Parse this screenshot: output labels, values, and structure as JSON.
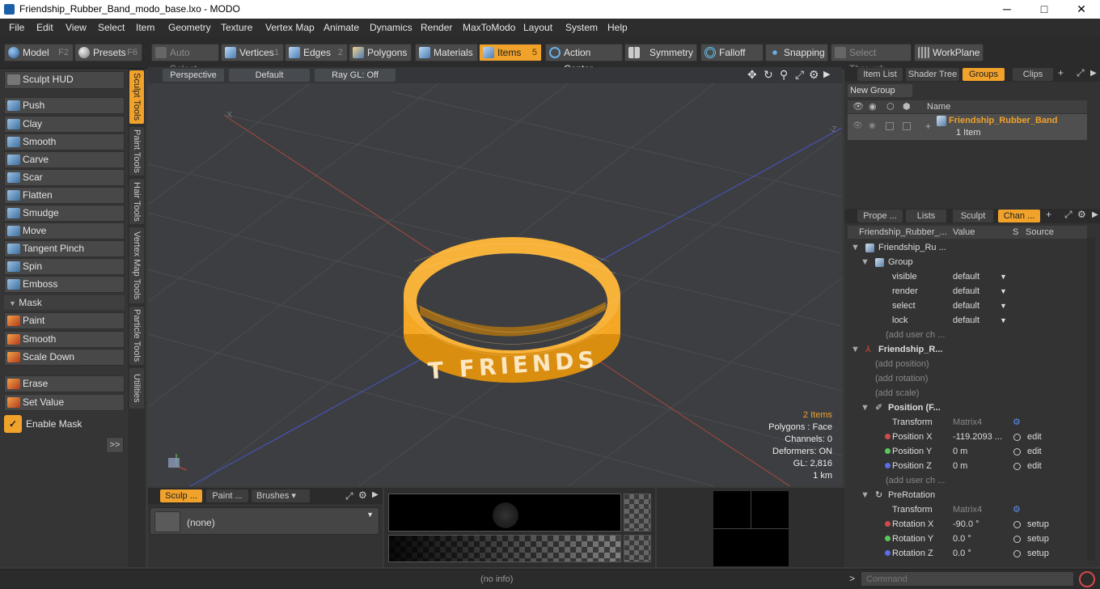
{
  "window": {
    "title": "Friendship_Rubber_Band_modo_base.lxo - MODO",
    "minimize": "─",
    "maximize": "□",
    "close": "✕"
  },
  "menu": [
    "File",
    "Edit",
    "View",
    "Select",
    "Item",
    "Geometry",
    "Texture",
    "Vertex Map",
    "Animate",
    "Dynamics",
    "Render",
    "MaxToModo",
    "Layout",
    "System",
    "Help"
  ],
  "toolbar": {
    "model": "Model",
    "model_key": "F2",
    "presets": "Presets",
    "presets_key": "F6",
    "auto_select": "Auto Select",
    "vertices": "Vertices",
    "vertices_key": "1",
    "edges": "Edges",
    "edges_key": "2",
    "polygons": "Polygons",
    "materials": "Materials",
    "items": "Items",
    "items_key": "5",
    "action_center": "Action Center",
    "symmetry": "Symmetry",
    "falloff": "Falloff",
    "snapping": "Snapping",
    "select_through": "Select Through",
    "workplane": "WorkPlane"
  },
  "left": {
    "sculpt_hud": "Sculpt HUD",
    "tools": [
      "Push",
      "Clay",
      "Smooth",
      "Carve",
      "Scar",
      "Flatten",
      "Smudge",
      "Move",
      "Tangent Pinch",
      "Spin",
      "Emboss"
    ],
    "mask_header": "Mask",
    "mask_tools": [
      "Paint",
      "Smooth",
      "Scale Down"
    ],
    "erase": "Erase",
    "set_value": "Set Value",
    "enable_mask": "Enable Mask",
    "expand": ">>",
    "vtabs": [
      "Sculpt Tools",
      "Paint Tools",
      "Hair Tools",
      "Vertex Map Tools",
      "Particle Tools",
      "Utilities"
    ]
  },
  "viewport": {
    "perspective": "Perspective",
    "default": "Default",
    "raygl": "Ray GL: Off",
    "band_text": "T FRIENDS",
    "axis_neg_x": "-X",
    "axis_neg_z": "-Z",
    "info": {
      "items": "2 Items",
      "polygons": "Polygons : Face",
      "channels": "Channels: 0",
      "deformers": "Deformers: ON",
      "gl": "GL: 2,816",
      "scale": "1 km"
    }
  },
  "bottom": {
    "tab_sculpt": "Sculp ...",
    "tab_paint": "Paint ...",
    "tab_brushes": "Brushes",
    "none": "(none)"
  },
  "items_panel": {
    "tabs": [
      "Item List",
      "Shader Tree",
      "Groups",
      "Clips"
    ],
    "new_group": "New Group",
    "name_col": "Name",
    "group_name": "Friendship_Rubber_Band",
    "group_count": "1 Item"
  },
  "channels_panel": {
    "tabs": [
      "Prope ...",
      "Lists",
      "Sculpt",
      "Chan ..."
    ],
    "headers": {
      "name": "Friendship_Rubber_...",
      "value": "Value",
      "s": "S",
      "source": "Source"
    },
    "rows": [
      {
        "name": "Friendship_Ru ...",
        "value": "",
        "src": ""
      },
      {
        "name": "Group",
        "value": "",
        "src": ""
      },
      {
        "name": "visible",
        "value": "default",
        "src": ""
      },
      {
        "name": "render",
        "value": "default",
        "src": ""
      },
      {
        "name": "select",
        "value": "default",
        "src": ""
      },
      {
        "name": "lock",
        "value": "default",
        "src": ""
      },
      {
        "name": "(add user ch ...",
        "value": "",
        "src": ""
      },
      {
        "name": "Friendship_R...",
        "value": "",
        "src": ""
      },
      {
        "name": "(add position)",
        "value": "",
        "src": ""
      },
      {
        "name": "(add rotation)",
        "value": "",
        "src": ""
      },
      {
        "name": "(add scale)",
        "value": "",
        "src": ""
      },
      {
        "name": "Position (F...",
        "value": "",
        "src": ""
      },
      {
        "name": "Transform",
        "value": "Matrix4",
        "src": ""
      },
      {
        "name": "Position X",
        "value": "-119.2093 ...",
        "src": "edit"
      },
      {
        "name": "Position Y",
        "value": "0 m",
        "src": "edit"
      },
      {
        "name": "Position Z",
        "value": "0 m",
        "src": "edit"
      },
      {
        "name": "(add user ch ...",
        "value": "",
        "src": ""
      },
      {
        "name": "PreRotation",
        "value": "",
        "src": ""
      },
      {
        "name": "Transform",
        "value": "Matrix4",
        "src": ""
      },
      {
        "name": "Rotation X",
        "value": "-90.0 °",
        "src": "setup"
      },
      {
        "name": "Rotation Y",
        "value": "0.0 °",
        "src": "setup"
      },
      {
        "name": "Rotation Z",
        "value": "0.0 °",
        "src": "setup"
      }
    ]
  },
  "status": {
    "info": "(no info)",
    "command_placeholder": "Command",
    "prompt": ">"
  },
  "colors": {
    "accent": "#f0a22b",
    "band": "#f5a623",
    "x_axis": "#b04a3a",
    "z_axis": "#4a55c8"
  }
}
